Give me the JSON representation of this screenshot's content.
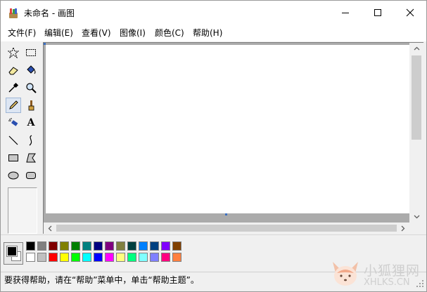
{
  "window": {
    "title": "未命名 - 画图"
  },
  "menubar": {
    "items": [
      {
        "label": "文件(F)"
      },
      {
        "label": "编辑(E)"
      },
      {
        "label": "查看(V)"
      },
      {
        "label": "图像(I)"
      },
      {
        "label": "颜色(C)"
      },
      {
        "label": "帮助(H)"
      }
    ]
  },
  "toolbox": {
    "tools": [
      {
        "name": "free-form-select",
        "icon": "star-select-icon"
      },
      {
        "name": "select",
        "icon": "rect-select-icon"
      },
      {
        "name": "eraser",
        "icon": "eraser-icon"
      },
      {
        "name": "fill",
        "icon": "fill-bucket-icon"
      },
      {
        "name": "pick-color",
        "icon": "eyedropper-icon"
      },
      {
        "name": "magnifier",
        "icon": "magnifier-icon"
      },
      {
        "name": "pencil",
        "icon": "pencil-icon",
        "selected": true
      },
      {
        "name": "brush",
        "icon": "brush-icon"
      },
      {
        "name": "airbrush",
        "icon": "airbrush-icon"
      },
      {
        "name": "text",
        "icon": "text-icon",
        "glyph": "A"
      },
      {
        "name": "line",
        "icon": "line-icon"
      },
      {
        "name": "curve",
        "icon": "curve-icon"
      },
      {
        "name": "rectangle",
        "icon": "rectangle-icon"
      },
      {
        "name": "polygon",
        "icon": "polygon-icon"
      },
      {
        "name": "ellipse",
        "icon": "ellipse-icon"
      },
      {
        "name": "rounded-rectangle",
        "icon": "rounded-rectangle-icon"
      }
    ]
  },
  "colors": {
    "foreground": "#000000",
    "background": "#ffffff",
    "palette_top": [
      "#000000",
      "#808080",
      "#800000",
      "#808000",
      "#008000",
      "#008080",
      "#000080",
      "#800080",
      "#808040",
      "#004040",
      "#0080ff",
      "#004080",
      "#8000ff",
      "#804000"
    ],
    "palette_bottom": [
      "#ffffff",
      "#c0c0c0",
      "#ff0000",
      "#ffff00",
      "#00ff00",
      "#00ffff",
      "#0000ff",
      "#ff00ff",
      "#ffff80",
      "#00ff80",
      "#80ffff",
      "#8080ff",
      "#ff0080",
      "#ff8040"
    ]
  },
  "statusbar": {
    "text": "要获得帮助，请在“帮助”菜单中，单击“帮助主题”。"
  },
  "watermark": {
    "name": "小狐狸网",
    "domain": "XHLKS.CN"
  }
}
